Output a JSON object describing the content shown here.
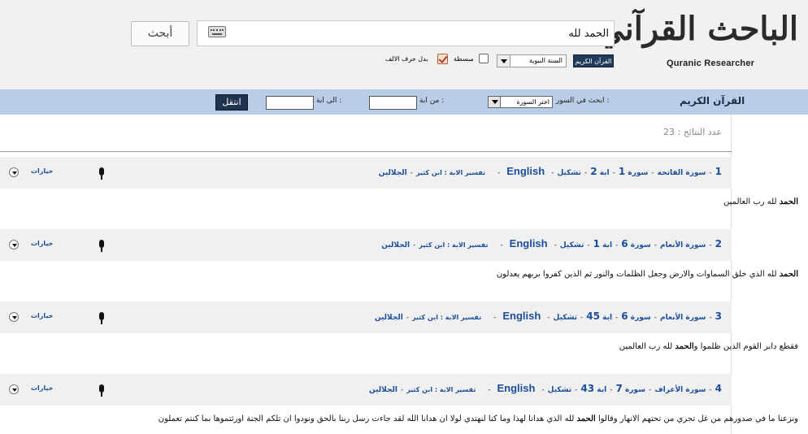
{
  "header": {
    "logo_ar": "الباحث القرآني",
    "logo_en": "Quranic Researcher",
    "search_value": "الحمد لله",
    "search_button": "أبحث",
    "opt_quran": "القرآن الكريم",
    "opt_sunna": "السنة النبوية",
    "opt_simplified": "مبسطة",
    "opt_alef": "بدل حرف الالف"
  },
  "navbar": {
    "title": "القرآن الكريم",
    "sura_label": "ابحث في السور :",
    "sura_select": "اختر السورة",
    "from_label": "من ابة :",
    "to_label": "الى ابة :",
    "go_button": "انتقل"
  },
  "results_count": "عدد النتائج : 23",
  "results": [
    {
      "num": "1",
      "sura_name": "سورة الفاتحة",
      "sura_label": "سورة",
      "sura_no": "1",
      "aya_label": "ابة",
      "aya_no": "2",
      "tashkeel": "تشكيل",
      "english": "English",
      "tafsir": "تفسير الابة : ابن كثير",
      "jalalain": "الجلالين",
      "options": "خيارات",
      "verse_pre": "",
      "verse_bold": "الحمد",
      "verse_post": " لله رب العالمين"
    },
    {
      "num": "2",
      "sura_name": "سورة الأنعام",
      "sura_label": "سورة",
      "sura_no": "6",
      "aya_label": "ابة",
      "aya_no": "1",
      "tashkeel": "تشكيل",
      "english": "English",
      "tafsir": "تفسير الابة : ابن كثير",
      "jalalain": "الجلالين",
      "options": "خيارات",
      "verse_pre": "",
      "verse_bold": "الحمد",
      "verse_post": " لله الذي خلق السماوات والارض وجعل الظلمات والنور ثم الذين كفروا بربهم يعدلون"
    },
    {
      "num": "3",
      "sura_name": "سورة الأنعام",
      "sura_label": "سورة",
      "sura_no": "6",
      "aya_label": "ابة",
      "aya_no": "45",
      "tashkeel": "تشكيل",
      "english": "English",
      "tafsir": "تفسير الابة : ابن كثير",
      "jalalain": "الجلالين",
      "options": "خيارات",
      "verse_pre": "فقطع دابر القوم الذين ظلموا و",
      "verse_bold": "الحمد",
      "verse_post": " لله رب العالمين"
    },
    {
      "num": "4",
      "sura_name": "سورة الأعراف",
      "sura_label": "سورة",
      "sura_no": "7",
      "aya_label": "ابة",
      "aya_no": "43",
      "tashkeel": "تشكيل",
      "english": "English",
      "tafsir": "تفسير الابة : ابن كثير",
      "jalalain": "الجلالين",
      "options": "خيارات",
      "verse_pre": "ونزعنا ما في صدورهم من غل تجري من تحتهم الانهار وقالوا ",
      "verse_bold": "الحمد",
      "verse_post": " لله الذي هدانا لهذا وما كنا لنهتدي لولا ان هدانا الله لقد جاءت رسل ربنا بالحق ونودوا ان تلكم الجنة اورثتموها بما كنتم تعملون"
    }
  ]
}
